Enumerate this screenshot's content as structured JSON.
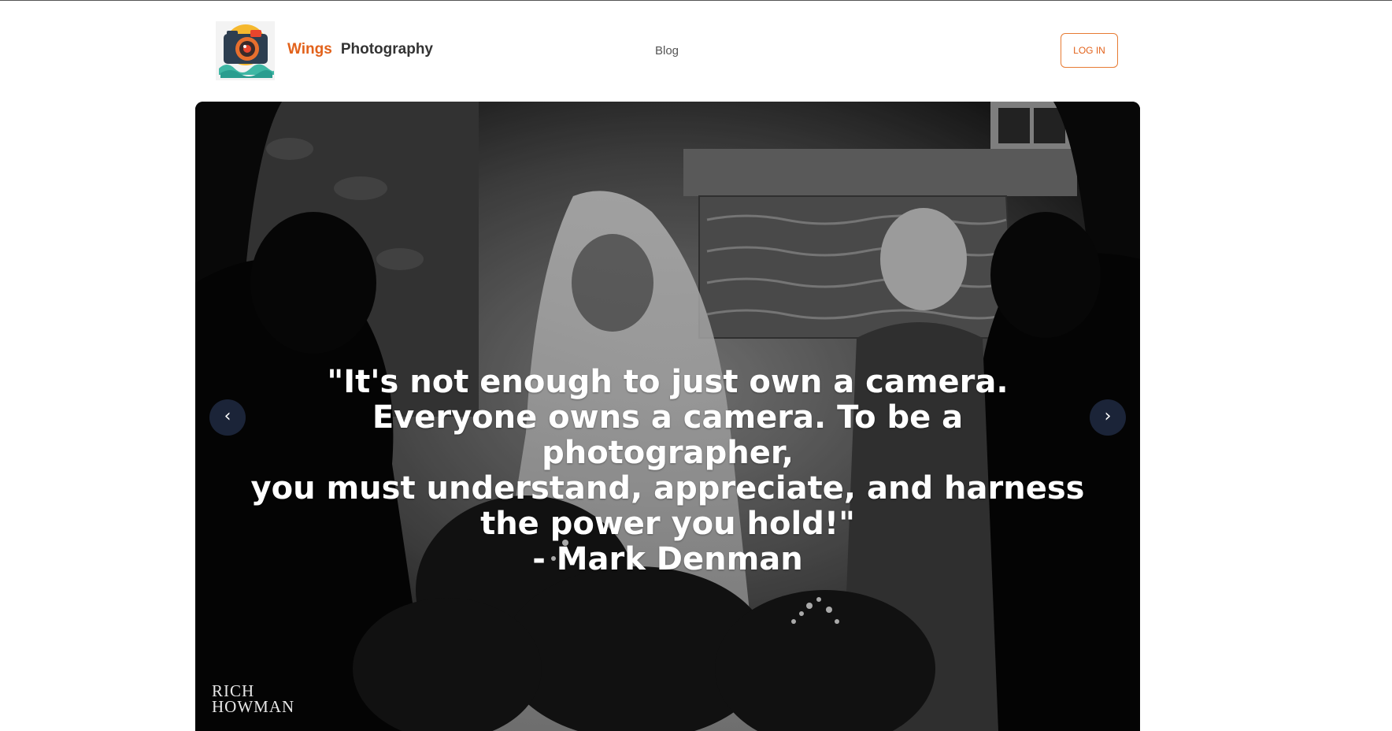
{
  "header": {
    "logo_icon": "camera-logo-icon",
    "brand_primary": "Wings",
    "brand_secondary": "Photography",
    "nav": {
      "blog_label": "Blog"
    },
    "login_label": "LOG IN"
  },
  "hero": {
    "quote_lines": "\"It's not enough to just own a camera.\nEveryone owns a camera. To be a photographer,\nyou must understand, appreciate, and harness\nthe power you hold!\"",
    "author": "- Mark Denman",
    "prev_label": "‹",
    "next_label": "›",
    "watermark_line1": "RICH",
    "watermark_line2": "HOWMAN"
  },
  "colors": {
    "brand_orange": "#e2621b",
    "arrow_bg": "#1e283e",
    "text_dark": "#333333"
  }
}
